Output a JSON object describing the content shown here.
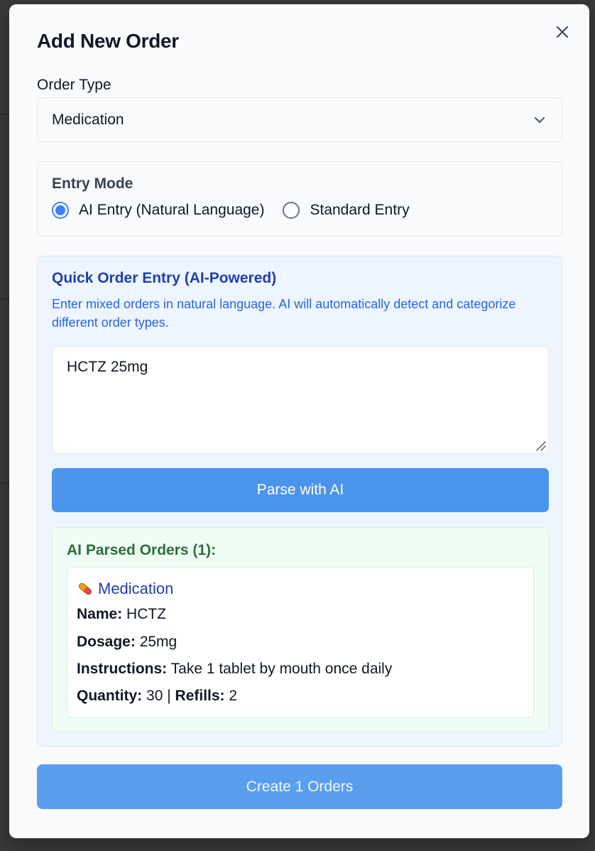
{
  "modal": {
    "title": "Add New Order",
    "close_icon": "close-icon"
  },
  "order_type": {
    "label": "Order Type",
    "selected": "Medication",
    "icon": "chevron-down-icon"
  },
  "entry_mode": {
    "title": "Entry Mode",
    "options": [
      {
        "label": "AI Entry (Natural Language)",
        "checked": true
      },
      {
        "label": "Standard Entry",
        "checked": false
      }
    ]
  },
  "ai_panel": {
    "title": "Quick Order Entry (AI-Powered)",
    "description": "Enter mixed orders in natural language. AI will automatically detect and categorize different order types.",
    "input_value": "HCTZ 25mg",
    "parse_button": "Parse with AI"
  },
  "parsed": {
    "title": "AI Parsed Orders (1):",
    "orders": [
      {
        "icon": "pill-icon",
        "category": "Medication",
        "name_label": "Name:",
        "name": "HCTZ",
        "dosage_label": "Dosage:",
        "dosage": "25mg",
        "instructions_label": "Instructions:",
        "instructions": "Take 1 tablet by mouth once daily",
        "quantity_label": "Quantity:",
        "quantity": "30",
        "separator": "|",
        "refills_label": "Refills:",
        "refills": "2"
      }
    ]
  },
  "create_button": "Create 1 Orders",
  "colors": {
    "primary": "#4b94ec",
    "ai_title": "#1e40af",
    "parsed_title": "#2f6d3c"
  }
}
